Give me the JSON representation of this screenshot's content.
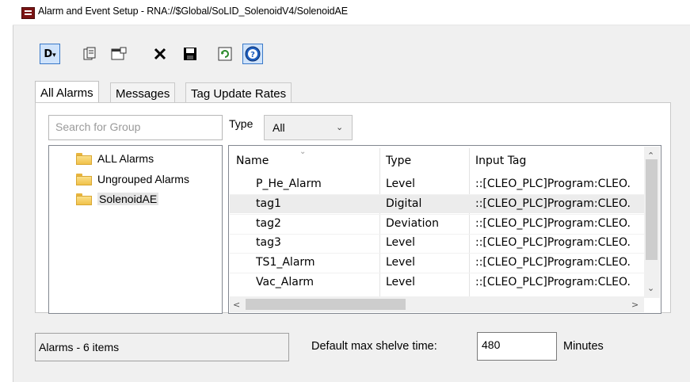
{
  "window": {
    "title": "Alarm and Event Setup - RNA://$Global/SoLID_SolenoidV4/SolenoidAE"
  },
  "toolbar": {
    "buttons": [
      {
        "name": "new-dropdown",
        "icon": "new-document-icon",
        "glyph": "D."
      },
      {
        "name": "paste",
        "icon": "paste-icon",
        "glyph": "⎘"
      },
      {
        "name": "properties",
        "icon": "properties-icon",
        "glyph": "▤"
      },
      {
        "name": "delete",
        "icon": "delete-icon",
        "glyph": "✕"
      },
      {
        "name": "save",
        "icon": "save-icon",
        "glyph": "■"
      },
      {
        "name": "refresh",
        "icon": "refresh-icon",
        "glyph": "↻"
      },
      {
        "name": "help",
        "icon": "help-icon",
        "glyph": "?"
      }
    ]
  },
  "tabs": [
    "All Alarms",
    "Messages",
    "Tag Update Rates"
  ],
  "search": {
    "placeholder": "Search for Group"
  },
  "type_filter": {
    "label": "Type",
    "value": "All"
  },
  "tree": [
    "ALL Alarms",
    "Ungrouped Alarms",
    "SolenoidAE"
  ],
  "grid": {
    "columns": [
      "Name",
      "Type",
      "Input Tag"
    ],
    "rows": [
      {
        "name": "P_He_Alarm",
        "type": "Level",
        "input": "::[CLEO_PLC]Program:CLEO."
      },
      {
        "name": "tag1",
        "type": "Digital",
        "input": "::[CLEO_PLC]Program:CLEO."
      },
      {
        "name": "tag2",
        "type": "Deviation",
        "input": "::[CLEO_PLC]Program:CLEO."
      },
      {
        "name": "tag3",
        "type": "Level",
        "input": "::[CLEO_PLC]Program:CLEO."
      },
      {
        "name": "TS1_Alarm",
        "type": "Level",
        "input": "::[CLEO_PLC]Program:CLEO."
      },
      {
        "name": "Vac_Alarm",
        "type": "Level",
        "input": "::[CLEO_PLC]Program:CLEO."
      }
    ]
  },
  "status": {
    "text": "Alarms - 6 items"
  },
  "shelve": {
    "label": "Default max shelve time:",
    "value": "480",
    "unit": "Minutes"
  },
  "colors": {
    "selection": "#e5e5e5",
    "toolbar_active": "#cfe3fb",
    "folder": "#f0c14a"
  }
}
